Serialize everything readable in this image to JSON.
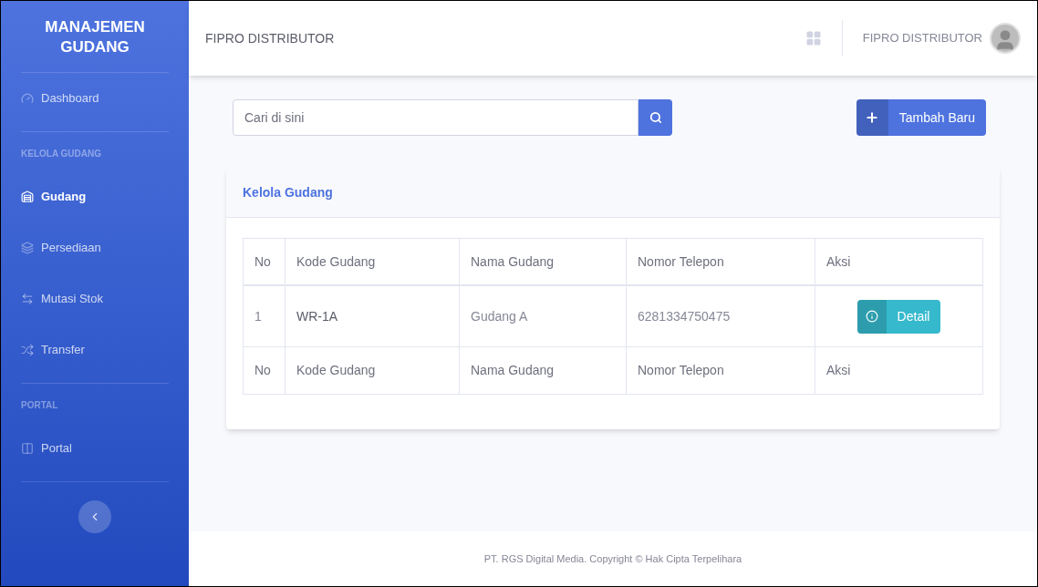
{
  "sidebar": {
    "brand": "MANAJEMEN GUDANG",
    "items": [
      {
        "kind": "item",
        "label": "Dashboard",
        "selected": false
      },
      {
        "kind": "divider"
      },
      {
        "kind": "heading",
        "label": "KELOLA GUDANG"
      },
      {
        "kind": "item",
        "label": "Gudang",
        "selected": true
      },
      {
        "kind": "item",
        "label": "Persediaan",
        "selected": false
      },
      {
        "kind": "item",
        "label": "Mutasi Stok",
        "selected": false
      },
      {
        "kind": "item",
        "label": "Transfer",
        "selected": false
      },
      {
        "kind": "divider"
      },
      {
        "kind": "heading",
        "label": "PORTAL"
      },
      {
        "kind": "item",
        "label": "Portal",
        "selected": false
      },
      {
        "kind": "divider"
      }
    ]
  },
  "topbar": {
    "title": "FIPRO DISTRIBUTOR",
    "user": "FIPRO DISTRIBUTOR"
  },
  "search": {
    "placeholder": "Cari di sini"
  },
  "add_button": "Tambah Baru",
  "card": {
    "title": "Kelola Gudang",
    "table": {
      "columns": [
        "No",
        "Kode Gudang",
        "Nama Gudang",
        "Nomor Telepon",
        "Aksi"
      ],
      "rows": [
        {
          "no": "1",
          "kode": "WR-1A",
          "nama": "Gudang A",
          "telepon": "6281334750475",
          "action": "Detail"
        }
      ],
      "footer": [
        "No",
        "Kode Gudang",
        "Nama Gudang",
        "Nomor Telepon",
        "Aksi"
      ]
    }
  },
  "footer": "PT. RGS Digital Media. Copyright © Hak Cipta Terpelihara"
}
